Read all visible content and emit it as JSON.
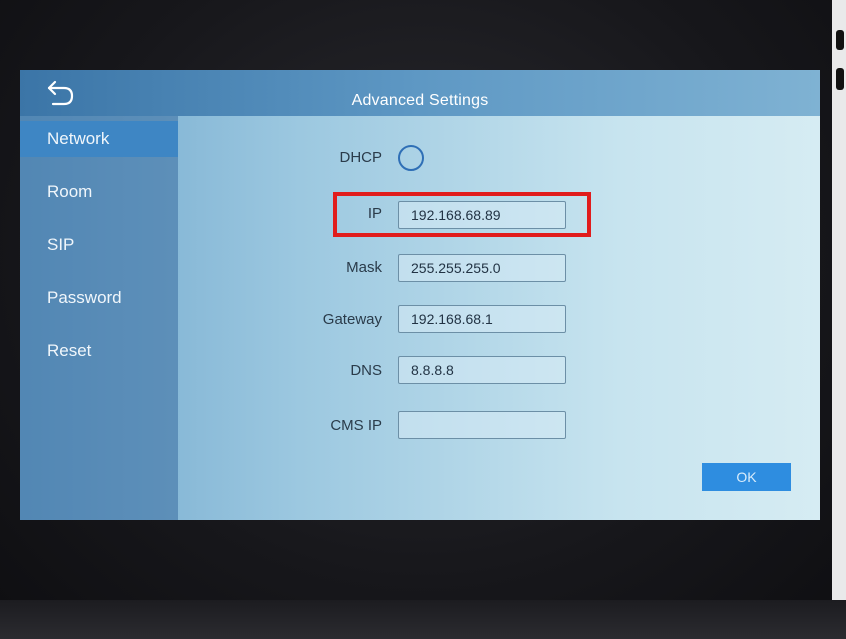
{
  "header": {
    "title": "Advanced Settings",
    "back_icon": "back-arrow-icon"
  },
  "sidebar": {
    "items": [
      {
        "label": "Network",
        "active": true
      },
      {
        "label": "Room",
        "active": false
      },
      {
        "label": "SIP",
        "active": false
      },
      {
        "label": "Password",
        "active": false
      },
      {
        "label": "Reset",
        "active": false
      }
    ]
  },
  "form": {
    "dhcp_label": "DHCP",
    "dhcp_checked": false,
    "ip_label": "IP",
    "ip_value": "192.168.68.89",
    "mask_label": "Mask",
    "mask_value": "255.255.255.0",
    "gateway_label": "Gateway",
    "gateway_value": "192.168.68.1",
    "dns_label": "DNS",
    "dns_value": "8.8.8.8",
    "cms_ip_label": "CMS IP",
    "cms_ip_value": ""
  },
  "ok_label": "OK",
  "colors": {
    "accent": "#2e8de0",
    "highlight": "#e11c1c",
    "active_nav": "#3e86c4"
  }
}
